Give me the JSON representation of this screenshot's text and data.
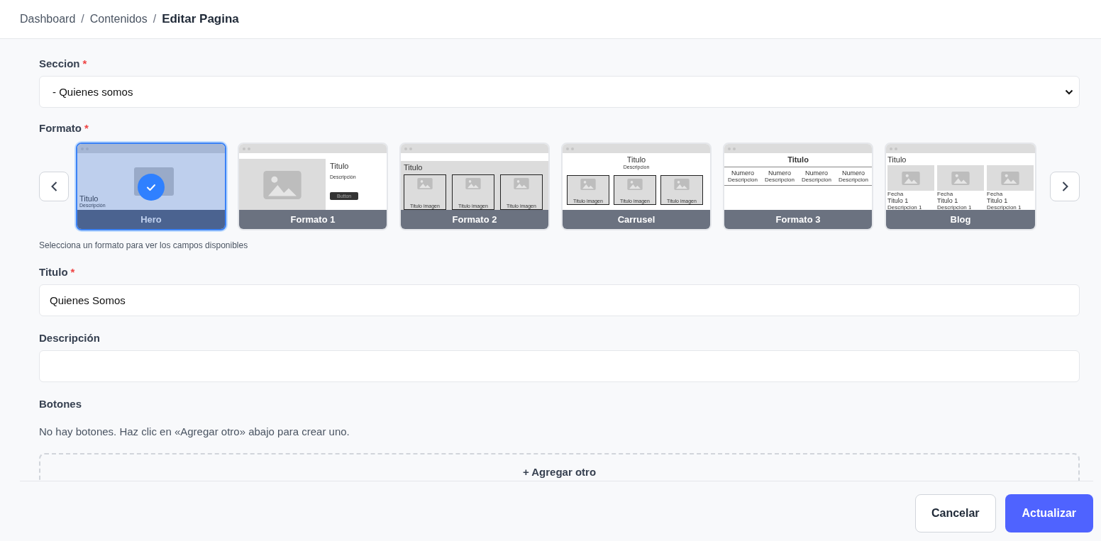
{
  "breadcrumb": {
    "separator": "/",
    "items": [
      {
        "label": "Dashboard",
        "current": false
      },
      {
        "label": "Contenidos",
        "current": false
      },
      {
        "label": "Editar Pagina",
        "current": true
      }
    ]
  },
  "seccion": {
    "label": "Seccion",
    "required_mark": "*",
    "value": "- Quienes somos"
  },
  "formato": {
    "label": "Formato",
    "required_mark": "*",
    "hint": "Selecciona un formato para ver los campos disponibles",
    "formats": [
      {
        "kind": "hero",
        "label": "Hero",
        "selected": true,
        "title": "Titulo",
        "description": "Descripción"
      },
      {
        "kind": "image-left",
        "label": "Formato 1",
        "selected": false,
        "title": "Titulo",
        "description": "Descripción",
        "button": "Button"
      },
      {
        "kind": "image-row",
        "label": "Formato 2",
        "selected": false,
        "title": "Titulo",
        "items": [
          "Titulo imagen",
          "Titulo imagen",
          "Titulo imagen"
        ]
      },
      {
        "kind": "carousel",
        "label": "Carrusel",
        "selected": false,
        "title": "Titulo",
        "description": "Descripcion",
        "items": [
          "Titulo imagen",
          "Titulo imagen",
          "Titulo imagen"
        ]
      },
      {
        "kind": "stats",
        "label": "Formato 3",
        "selected": false,
        "title": "Titulo",
        "stats": [
          {
            "number": "Numero",
            "description": "Descripcion"
          },
          {
            "number": "Numero",
            "description": "Descripcion"
          },
          {
            "number": "Numero",
            "description": "Descripcion"
          },
          {
            "number": "Numero",
            "description": "Descripcion"
          }
        ]
      },
      {
        "kind": "blog",
        "label": "Blog",
        "selected": false,
        "title": "Titulo",
        "posts": [
          {
            "date": "Fecha",
            "title": "Titulo 1",
            "description": "Descripcion 1"
          },
          {
            "date": "Fecha",
            "title": "Titulo 1",
            "description": "Descripcion 1"
          },
          {
            "date": "Fecha",
            "title": "Titulo 1",
            "description": "Descripcion 1"
          }
        ]
      }
    ]
  },
  "titulo": {
    "label": "Titulo",
    "required_mark": "*",
    "value": "Quienes Somos"
  },
  "descripcion": {
    "label": "Descripción"
  },
  "botones": {
    "label": "Botones",
    "empty_message": "No hay botones. Haz clic en «Agregar otro» abajo para crear uno.",
    "add_label": "+ Agregar otro"
  },
  "footer": {
    "cancel": "Cancelar",
    "submit": "Actualizar"
  }
}
